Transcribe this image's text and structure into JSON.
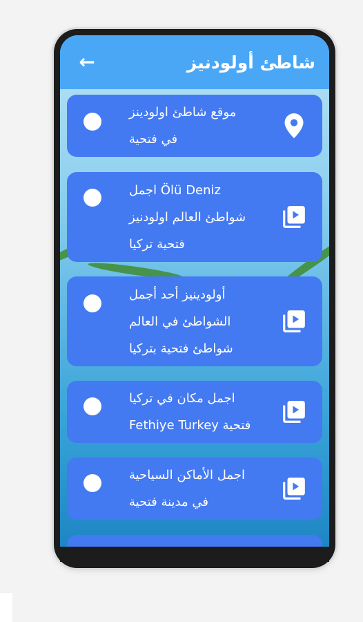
{
  "header": {
    "title": "شاطئ أولودنيز"
  },
  "items": [
    {
      "lines": [
        "موقع شاطئ اولودينز",
        "في فتحية"
      ],
      "icon": "location-pin-icon"
    },
    {
      "lines": [
        "Ölü Deniz  اجمل",
        "شواطئ العالم اولودنيز",
        "فتحية  تركيا"
      ],
      "icon": "video-library-icon"
    },
    {
      "lines": [
        "أولودينيز  أحد أجمل",
        "الشواطئ في العالم",
        "شواطئ فتحية بتركيا"
      ],
      "icon": "video-library-icon"
    },
    {
      "lines": [
        "اجمل مكان في تركيا",
        "فتحية Fethiye Turkey"
      ],
      "icon": "video-library-icon"
    },
    {
      "lines": [
        "اجمل الأماكن السياحية",
        "في مدينة فتحية"
      ],
      "icon": "video-library-icon"
    }
  ],
  "colors": {
    "header": "#4aa7f5",
    "card": "#4379f1",
    "text": "#ffffff"
  }
}
